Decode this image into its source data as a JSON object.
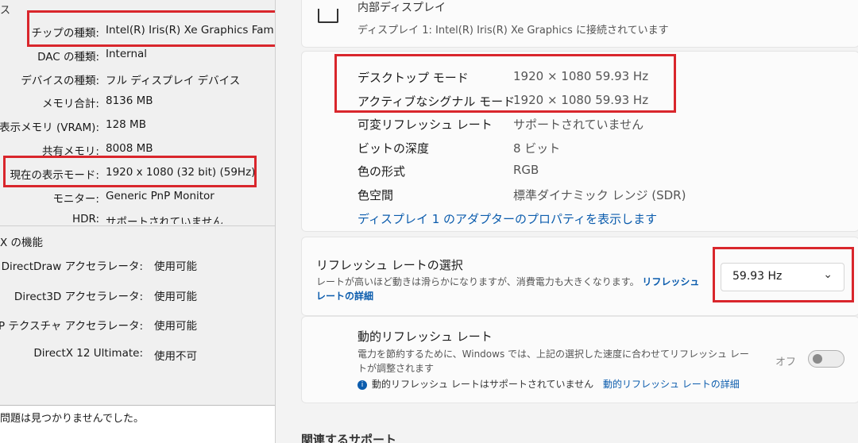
{
  "dxdiag": {
    "header_fragment": "ス",
    "system_rows": [
      {
        "label": "チップの種類:",
        "value": "Intel(R) Iris(R) Xe Graphics Family"
      },
      {
        "label": "DAC の種類:",
        "value": "Internal"
      },
      {
        "label": "デバイスの種類:",
        "value": "フル ディスプレイ デバイス"
      },
      {
        "label": "メモリ合計:",
        "value": "8136 MB"
      },
      {
        "label": "表示メモリ (VRAM):",
        "value": "128 MB"
      },
      {
        "label": "共有メモリ:",
        "value": "8008 MB"
      },
      {
        "label": "現在の表示モード:",
        "value": "1920 x 1080 (32 bit) (59Hz)"
      },
      {
        "label": "モニター:",
        "value": "Generic PnP Monitor"
      },
      {
        "label": "HDR:",
        "value": "サポートされていません"
      }
    ],
    "features_title": "X の機能",
    "features": [
      {
        "label": "DirectDraw アクセラレータ:",
        "value": "使用可能"
      },
      {
        "label": "Direct3D アクセラレータ:",
        "value": "使用可能"
      },
      {
        "label": "AGP テクスチャ アクセラレータ:",
        "value": "使用可能"
      },
      {
        "label": "DirectX 12 Ultimate:",
        "value": "使用不可"
      }
    ],
    "notes": "問題は見つかりませんでした。"
  },
  "settings": {
    "display": {
      "title": "内部ディスプレイ",
      "subtitle": "ディスプレイ 1: Intel(R) Iris(R) Xe Graphics に接続されています"
    },
    "info_rows": [
      {
        "key": "デスクトップ モード",
        "value": "1920 × 1080 59.93 Hz"
      },
      {
        "key": "アクティブなシグナル モード",
        "value": "1920 × 1080 59.93 Hz"
      },
      {
        "key": "可変リフレッシュ レート",
        "value": "サポートされていません"
      },
      {
        "key": "ビットの深度",
        "value": "8 ビット"
      },
      {
        "key": "色の形式",
        "value": "RGB"
      },
      {
        "key": "色空間",
        "value": "標準ダイナミック レンジ (SDR)"
      }
    ],
    "adapter_link": "ディスプレイ 1 のアダプターのプロパティを表示します",
    "refresh": {
      "title": "リフレッシュ レートの選択",
      "desc": "レートが高いほど動きは滑らかになりますが、消費電力も大きくなります。",
      "link": "リフレッシュ レートの詳細",
      "selected": "59.93 Hz"
    },
    "dynamic": {
      "title": "動的リフレッシュ レート",
      "desc": "電力を節約するために、Windows では、上記の選択した速度に合わせてリフレッシュ レートが調整されます",
      "note": "動的リフレッシュ レートはサポートされていません",
      "note_link": "動的リフレッシュ レートの詳細",
      "toggle_label": "オフ",
      "toggle_on": false
    },
    "related_heading": "関連するサポート"
  },
  "colors": {
    "highlight": "#d9262c",
    "link": "#0b5cad"
  }
}
